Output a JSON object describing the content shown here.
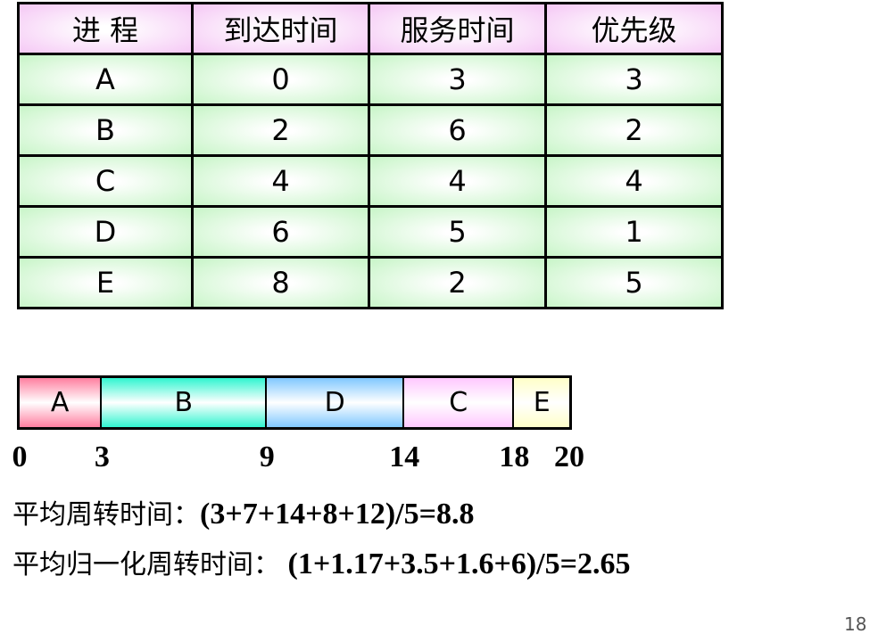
{
  "table": {
    "headers": [
      "进 程",
      "到达时间",
      "服务时间",
      "优先级"
    ],
    "rows": [
      [
        "A",
        "0",
        "3",
        "3"
      ],
      [
        "B",
        "2",
        "6",
        "2"
      ],
      [
        "C",
        "4",
        "4",
        "4"
      ],
      [
        "D",
        "6",
        "5",
        "1"
      ],
      [
        "E",
        "8",
        "2",
        "5"
      ]
    ]
  },
  "gantt": {
    "segments": [
      {
        "label": "A",
        "start": 0,
        "end": 3,
        "color": "#ff7fa0"
      },
      {
        "label": "B",
        "start": 3,
        "end": 9,
        "color": "#30f5d0"
      },
      {
        "label": "D",
        "start": 9,
        "end": 14,
        "color": "#80c8ff"
      },
      {
        "label": "C",
        "start": 14,
        "end": 18,
        "color": "#ffc8ff"
      },
      {
        "label": "E",
        "start": 18,
        "end": 20,
        "color": "#ffffc8"
      }
    ],
    "ticks": [
      "0",
      "3",
      "9",
      "14",
      "18",
      "20"
    ]
  },
  "avg_turnaround": {
    "label": "平均周转时间：",
    "formula": "(3+7+14+8+12)/5=8.8"
  },
  "avg_weighted": {
    "label": "平均归一化周转时间：",
    "formula": " (1+1.17+3.5+1.6+6)/5=2.65"
  },
  "page_number": "18"
}
